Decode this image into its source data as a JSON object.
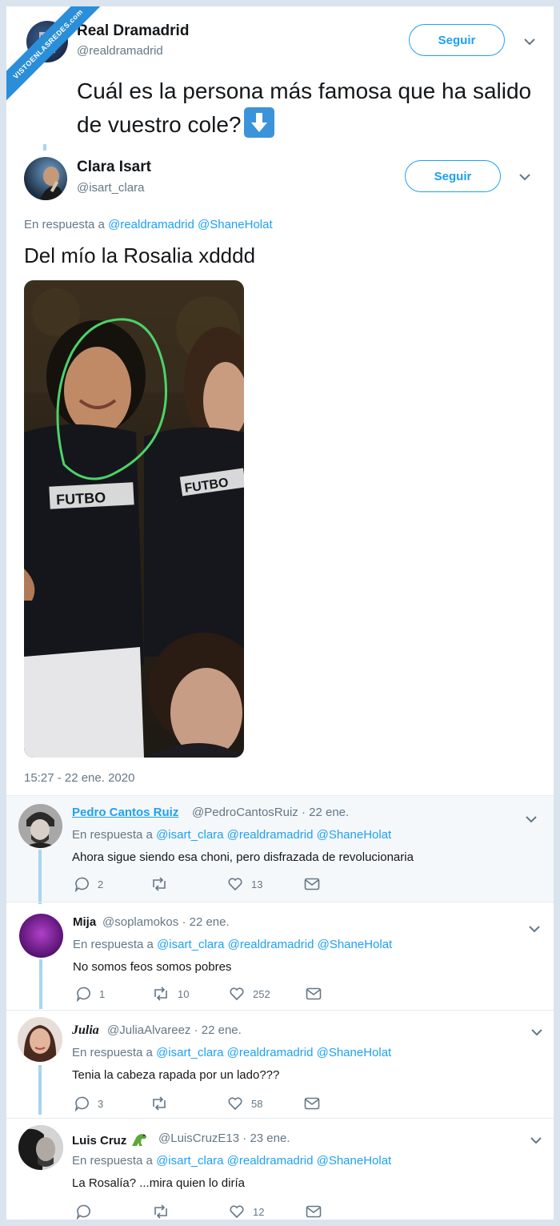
{
  "watermark": "VISTOENLASREDES.com",
  "original_tweet": {
    "name": "Real Dramadrid",
    "handle": "@realdramadrid",
    "follow_label": "Seguir",
    "text": "Cuál es la persona más famosa que ha salido de vuestro cole?"
  },
  "reply_tweet": {
    "name": "Clara Isart",
    "handle": "@isart_clara",
    "follow_label": "Seguir",
    "reply_prefix": "En respuesta a",
    "mentions": "@realdramadrid @ShaneHolat",
    "text": "Del mío la Rosalia xdddd",
    "timestamp": "15:27 - 22 ene. 2020"
  },
  "replies": [
    {
      "name": "Pedro Cantos Ruiz",
      "handle": "@PedroCantosRuiz",
      "date": "· 22 ene.",
      "reply_prefix": "En respuesta a",
      "mentions": "@isart_clara @realdramadrid @ShaneHolat",
      "text": "Ahora sigue siendo esa choni, pero disfrazada de revolucionaria",
      "replies_count": "2",
      "retweets_count": "",
      "likes_count": "13"
    },
    {
      "name": "Mija",
      "handle": "@soplamokos",
      "date": "· 22 ene.",
      "reply_prefix": "En respuesta a",
      "mentions": "@isart_clara @realdramadrid @ShaneHolat",
      "text": "No somos feos somos pobres",
      "replies_count": "1",
      "retweets_count": "10",
      "likes_count": "252"
    },
    {
      "name": "Julia",
      "handle": "@JuliaAlvareez",
      "date": "· 22 ene.",
      "reply_prefix": "En respuesta a",
      "mentions": "@isart_clara @realdramadrid @ShaneHolat",
      "text": "Tenia la cabeza rapada por un lado???",
      "replies_count": "3",
      "retweets_count": "",
      "likes_count": "58"
    },
    {
      "name": "Luis Cruz",
      "handle": "@LuisCruzE13",
      "date": "· 23 ene.",
      "reply_prefix": "En respuesta a",
      "mentions": "@isart_clara @realdramadrid @ShaneHolat",
      "text": "La Rosalía? ...mira quien lo diría",
      "replies_count": "",
      "retweets_count": "",
      "likes_count": "12"
    }
  ],
  "colors": {
    "accent": "#1da1f2",
    "thread_line": "#a7d4f2",
    "secondary_text": "#657786",
    "highlight_bg": "#f5f8fa"
  },
  "icons": [
    "chevron-down-icon",
    "reply-icon",
    "retweet-icon",
    "like-icon",
    "dm-icon",
    "down-arrow-emoji",
    "dinosaur-emoji"
  ]
}
